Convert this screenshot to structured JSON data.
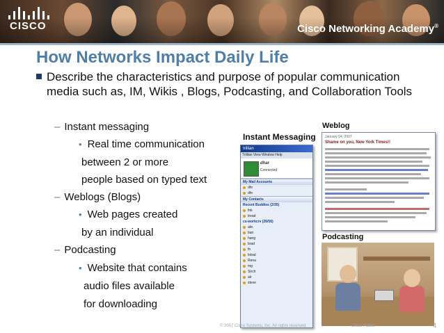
{
  "header": {
    "logo_text": "CISCO",
    "academy_text": "Cisco Networking Academy",
    "academy_mark": "®"
  },
  "slide": {
    "title": "How Networks Impact Daily Life",
    "main_bullet": "Describe the characteristics and purpose of popular communication media such as, IM, Wikis , Blogs, Podcasting, and Collaboration Tools",
    "items": [
      {
        "dash": "–",
        "label": "Instant messaging"
      },
      {
        "dot": "•",
        "label": "Real time communication"
      },
      {
        "label": "between 2 or more"
      },
      {
        "label": "people based on typed text"
      },
      {
        "dash": "–",
        "label": "Weblogs (Blogs)"
      },
      {
        "dot": "•",
        "label": "Web pages created"
      },
      {
        "label": "by an individual"
      },
      {
        "dash": "–",
        "label": "Podcasting"
      },
      {
        "dot": "•",
        "label": "Website that contains"
      },
      {
        "label": "audio files available"
      },
      {
        "label": "for downloading"
      }
    ]
  },
  "im_panel": {
    "caption": "Instant Messaging",
    "window_title": "trillian",
    "menu": "Trillian  View  Window  Help",
    "user_name": "dhar",
    "user_status": "Connected",
    "mail_section": "My Mail Accounts",
    "mail_rows": [
      "dhr",
      "dhr"
    ],
    "contacts_section": "My Contacts",
    "group_1": "Recent Buddies (2/35)",
    "group_1_rows": [
      "fnk",
      "tread"
    ],
    "group_2": "cs-workcrv (26/56)",
    "group_2_rows": [
      "abr.",
      "ban",
      "hang",
      "brad",
      "fn",
      "lotsal",
      "Rena",
      "mg",
      "Sirch",
      "alr",
      "steve"
    ]
  },
  "blog_panel": {
    "caption": "Weblog",
    "date": "January 04, 2007",
    "headline": "Shame on you, New York Times!!"
  },
  "podcast_panel": {
    "caption": "Podcasting"
  },
  "footer": {
    "copyright": "© 2007 Cisco Systems, Inc. All rights reserved.",
    "classification": "Cisco Public",
    "page": "4"
  },
  "colors": {
    "title": "#4f7ea6",
    "bullet_square": "#1e3d5e",
    "im_title_bar": "#123a8c"
  }
}
